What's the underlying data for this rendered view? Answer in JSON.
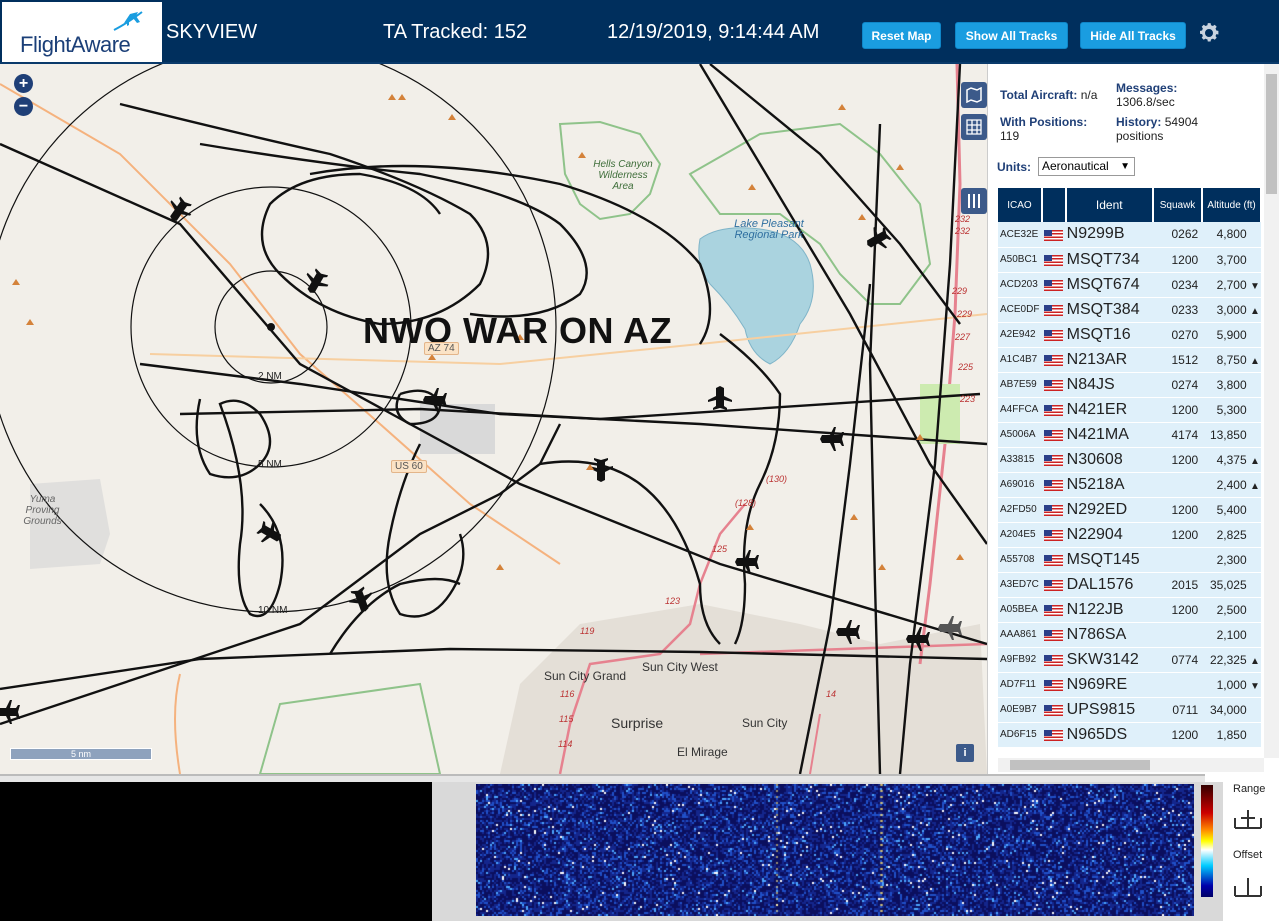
{
  "header": {
    "logo_text": "FlightAware",
    "app_title": "SKYVIEW",
    "tracked": "TA Tracked: 152",
    "datetime": "12/19/2019, 9:14:44 AM",
    "reset_label": "Reset Map",
    "show_label": "Show All Tracks",
    "hide_label": "Hide All Tracks"
  },
  "map": {
    "overlay_text": "NWO WAR ON AZ",
    "scale_label": "5 nm",
    "range_labels": [
      "2 NM",
      "5 NM",
      "10 NM"
    ],
    "road_labels": [
      "AZ 74",
      "US 60"
    ],
    "park_labels": [
      "Hells Canyon Wilderness Area",
      "Lake Pleasant Regional Park",
      "Yuma Proving Grounds"
    ],
    "city_labels": [
      "Sun City West",
      "Sun City Grand",
      "Surprise",
      "Sun City",
      "El Mirage"
    ]
  },
  "panel": {
    "total_aircraft_label": "Total Aircraft:",
    "total_aircraft_value": "n/a",
    "messages_label": "Messages:",
    "messages_value": "1306.8/sec",
    "positions_label": "With Positions:",
    "positions_value": "119",
    "history_label": "History:",
    "history_value": "54904",
    "history_unit": "positions",
    "units_label": "Units:",
    "units_value": "Aeronautical",
    "columns": [
      "ICAO",
      "Ident",
      "Squawk",
      "Altitude (ft)"
    ],
    "rows": [
      {
        "icao": "ACE32E",
        "ident": "N9299B",
        "squawk": "0262",
        "alt": "4,800",
        "trend": ""
      },
      {
        "icao": "A50BC1",
        "ident": "MSQT734",
        "squawk": "1200",
        "alt": "3,700",
        "trend": ""
      },
      {
        "icao": "ACD203",
        "ident": "MSQT674",
        "squawk": "0234",
        "alt": "2,700",
        "trend": "▼"
      },
      {
        "icao": "ACE0DF",
        "ident": "MSQT384",
        "squawk": "0233",
        "alt": "3,000",
        "trend": "▲"
      },
      {
        "icao": "A2E942",
        "ident": "MSQT16",
        "squawk": "0270",
        "alt": "5,900",
        "trend": ""
      },
      {
        "icao": "A1C4B7",
        "ident": "N213AR",
        "squawk": "1512",
        "alt": "8,750",
        "trend": "▲"
      },
      {
        "icao": "AB7E59",
        "ident": "N84JS",
        "squawk": "0274",
        "alt": "3,800",
        "trend": ""
      },
      {
        "icao": "A4FFCA",
        "ident": "N421ER",
        "squawk": "1200",
        "alt": "5,300",
        "trend": ""
      },
      {
        "icao": "A5006A",
        "ident": "N421MA",
        "squawk": "4174",
        "alt": "13,850",
        "trend": ""
      },
      {
        "icao": "A33815",
        "ident": "N30608",
        "squawk": "1200",
        "alt": "4,375",
        "trend": "▲"
      },
      {
        "icao": "A69016",
        "ident": "N5218A",
        "squawk": "",
        "alt": "2,400",
        "trend": "▲"
      },
      {
        "icao": "A2FD50",
        "ident": "N292ED",
        "squawk": "1200",
        "alt": "5,400",
        "trend": ""
      },
      {
        "icao": "A204E5",
        "ident": "N22904",
        "squawk": "1200",
        "alt": "2,825",
        "trend": ""
      },
      {
        "icao": "A55708",
        "ident": "MSQT145",
        "squawk": "",
        "alt": "2,300",
        "trend": ""
      },
      {
        "icao": "A3ED7C",
        "ident": "DAL1576",
        "squawk": "2015",
        "alt": "35,025",
        "trend": ""
      },
      {
        "icao": "A05BEA",
        "ident": "N122JB",
        "squawk": "1200",
        "alt": "2,500",
        "trend": ""
      },
      {
        "icao": "AAA861",
        "ident": "N786SA",
        "squawk": "",
        "alt": "2,100",
        "trend": ""
      },
      {
        "icao": "A9FB92",
        "ident": "SKW3142",
        "squawk": "0774",
        "alt": "22,325",
        "trend": "▲"
      },
      {
        "icao": "AD7F11",
        "ident": "N969RE",
        "squawk": "",
        "alt": "1,000",
        "trend": "▼"
      },
      {
        "icao": "A0E9B7",
        "ident": "UPS9815",
        "squawk": "0711",
        "alt": "34,000",
        "trend": ""
      },
      {
        "icao": "AD6F15",
        "ident": "N965DS",
        "squawk": "1200",
        "alt": "1,850",
        "trend": ""
      }
    ]
  },
  "bottom": {
    "range_label": "Range",
    "offset_label": "Offset"
  }
}
